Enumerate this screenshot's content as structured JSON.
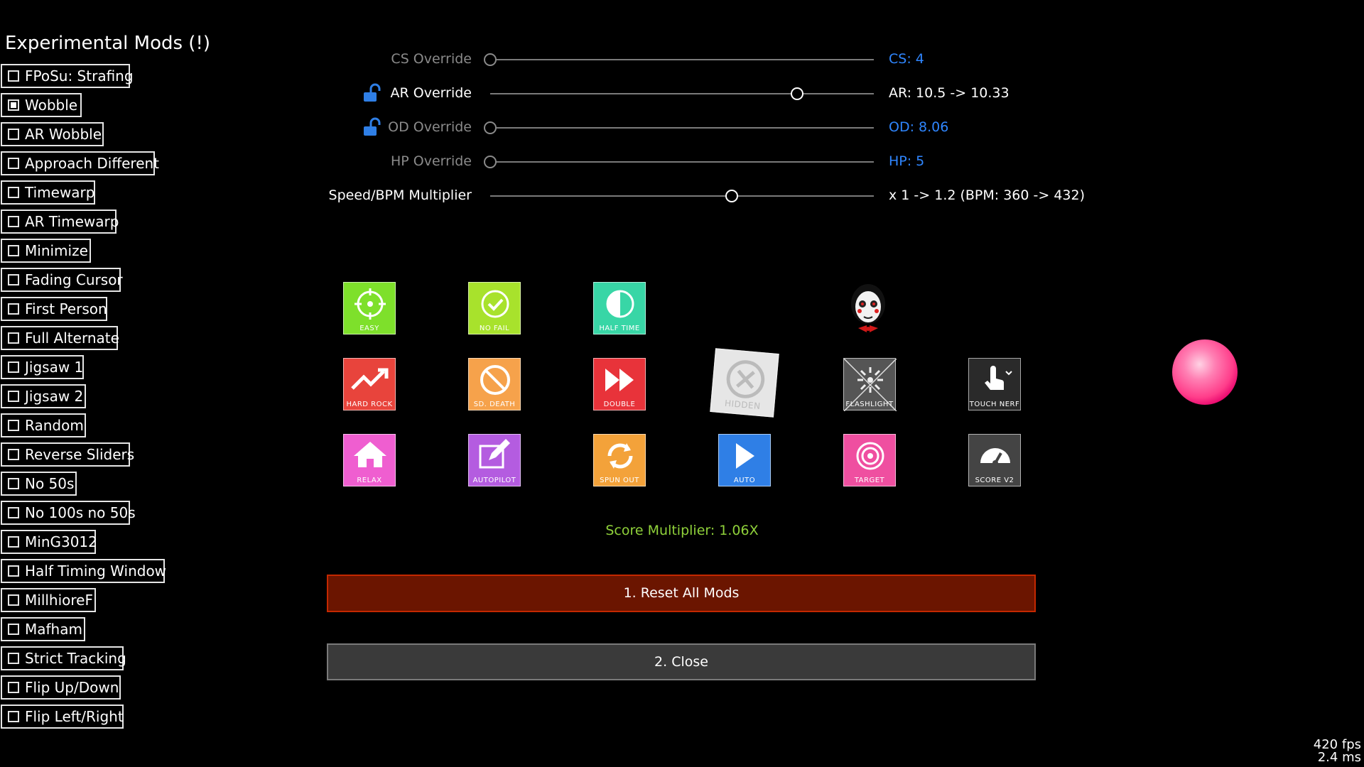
{
  "experimental": {
    "title": "Experimental Mods (!)",
    "items": [
      {
        "label": "FPoSu: Strafing",
        "checked": false
      },
      {
        "label": "Wobble",
        "checked": true
      },
      {
        "label": "AR Wobble",
        "checked": false
      },
      {
        "label": "Approach Different",
        "checked": false
      },
      {
        "label": "Timewarp",
        "checked": false
      },
      {
        "label": "AR Timewarp",
        "checked": false
      },
      {
        "label": "Minimize",
        "checked": false
      },
      {
        "label": "Fading Cursor",
        "checked": false
      },
      {
        "label": "First Person",
        "checked": false
      },
      {
        "label": "Full Alternate",
        "checked": false
      },
      {
        "label": "Jigsaw 1",
        "checked": false
      },
      {
        "label": "Jigsaw 2",
        "checked": false
      },
      {
        "label": "Random",
        "checked": false
      },
      {
        "label": "Reverse Sliders",
        "checked": false
      },
      {
        "label": "No 50s",
        "checked": false
      },
      {
        "label": "No 100s no 50s",
        "checked": false
      },
      {
        "label": "MinG3012",
        "checked": false
      },
      {
        "label": "Half Timing Window",
        "checked": false
      },
      {
        "label": "MillhioreF",
        "checked": false
      },
      {
        "label": "Mafham",
        "checked": false
      },
      {
        "label": "Strict Tracking",
        "checked": false
      },
      {
        "label": "Flip Up/Down",
        "checked": false
      },
      {
        "label": "Flip Left/Right",
        "checked": false
      }
    ]
  },
  "overrides": [
    {
      "label": "CS Override",
      "value": "CS: 4",
      "active": false,
      "locked": false,
      "position": 0.0
    },
    {
      "label": "AR Override",
      "value": "AR: 10.5 -> 10.33",
      "active": true,
      "locked": true,
      "position": 0.8
    },
    {
      "label": "OD Override",
      "value": "OD: 8.06",
      "active": false,
      "locked": true,
      "position": 0.0
    },
    {
      "label": "HP Override",
      "value": "HP: 5",
      "active": false,
      "locked": false,
      "position": 0.0
    },
    {
      "label": "Speed/BPM Multiplier",
      "value": "x 1 -> 1.2  (BPM: 360 -> 432)",
      "active": true,
      "locked": false,
      "position": 0.63
    }
  ],
  "mods": [
    {
      "caption": "EASY",
      "color": "#7ee02b",
      "icon": "crosshair-icon"
    },
    {
      "caption": "NO FAIL",
      "color": "#a8e22c",
      "icon": "checkmark-icon"
    },
    {
      "caption": "HALF TIME",
      "color": "#38d6a6",
      "icon": "half-circle-icon"
    },
    {
      "caption": "HARD ROCK",
      "color": "#e8443c",
      "icon": "trend-up-icon"
    },
    {
      "caption": "SD. DEATH",
      "color": "#f6a24b",
      "icon": "ban-icon"
    },
    {
      "caption": "DOUBLE",
      "color": "#e8333a",
      "icon": "fast-forward-icon"
    },
    {
      "caption": "HIDDEN",
      "color": "#e6e6e6",
      "icon": "close-circle-icon"
    },
    {
      "caption": "FLASHLIGHT",
      "color": "#555555",
      "icon": "flash-icon"
    },
    {
      "caption": "TOUCH NERF",
      "color": "#2a2a2a",
      "icon": "touch-icon"
    },
    {
      "caption": "RELAX",
      "color": "#ef5ed0",
      "icon": "home-icon"
    },
    {
      "caption": "AUTOPILOT",
      "color": "#b45ce0",
      "icon": "edit-icon"
    },
    {
      "caption": "SPUN OUT",
      "color": "#f3a23a",
      "icon": "refresh-icon"
    },
    {
      "caption": "AUTO",
      "color": "#2f7fe6",
      "icon": "play-icon"
    },
    {
      "caption": "TARGET",
      "color": "#ef4fa0",
      "icon": "target-icon"
    },
    {
      "caption": "SCORE V2",
      "color": "#444444",
      "icon": "gauge-icon"
    }
  ],
  "score_multiplier": "Score Multiplier: 1.06X",
  "buttons": {
    "reset": "1. Reset All Mods",
    "close": "2. Close"
  },
  "stats": {
    "fps": "420 fps",
    "frametime": "2.4 ms"
  },
  "colors": {
    "accent_blue": "#2f86ff",
    "score_green": "#8fd13a",
    "reset_red": "#6b1500"
  }
}
